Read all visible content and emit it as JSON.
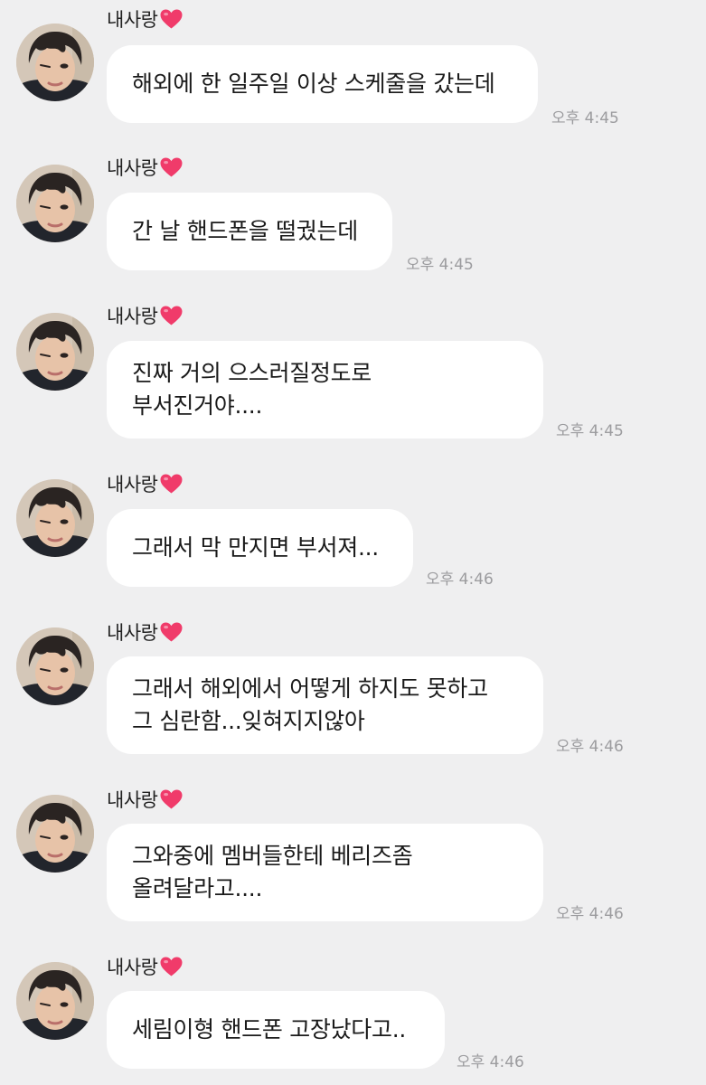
{
  "sender_name": "내사랑",
  "colors": {
    "background": "#efeff0",
    "bubble": "#ffffff",
    "heart": "#f03b6a",
    "time": "#9c9c9f"
  },
  "messages": [
    {
      "lines": [
        "해외에 한 일주일 이상 스케줄을 갔는데"
      ],
      "time": "오후 4:45"
    },
    {
      "lines": [
        "간 날 핸드폰을 떨궜는데"
      ],
      "time": "오후 4:45"
    },
    {
      "lines": [
        "진짜 거의 으스러질정도로",
        "부서진거야...."
      ],
      "time": "오후 4:45"
    },
    {
      "lines": [
        "그래서 막 만지면 부서져..."
      ],
      "time": "오후 4:46"
    },
    {
      "lines": [
        "그래서 해외에서 어떻게 하지도 못하고",
        "그 심란함...잊혀지지않아"
      ],
      "time": "오후 4:46"
    },
    {
      "lines": [
        "그와중에 멤버들한테 베리즈좀",
        "올려달라고...."
      ],
      "time": "오후 4:46"
    },
    {
      "lines": [
        "세림이형 핸드폰 고장났다고.."
      ],
      "time": "오후 4:46"
    }
  ]
}
